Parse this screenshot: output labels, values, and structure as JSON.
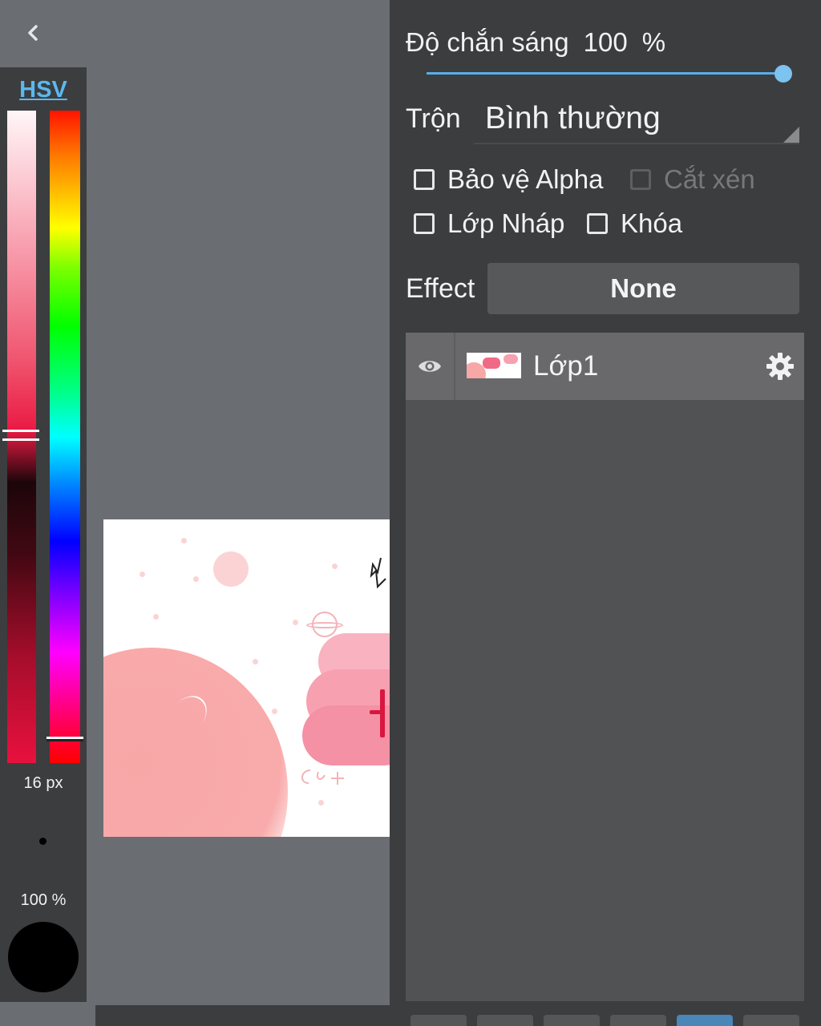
{
  "colors": {
    "accent": "#5bb8ee",
    "panel": "#3c3d3f",
    "canvas_bg": "#6a6d72",
    "current_color": "#000000"
  },
  "navigation": {
    "back_icon": "chevron-left-icon"
  },
  "color_panel": {
    "mode_label": "HSV",
    "brush_size": "16 px",
    "brush_opacity": "100 %",
    "saturation_level": 0.49,
    "hue_level": 0.96
  },
  "layer_properties": {
    "opacity_label": "Độ chắn sáng",
    "opacity_value": "100",
    "opacity_unit": "%",
    "opacity_slider": 1.0,
    "blend_label": "Trộn",
    "blend_value": "Bình thường",
    "checkboxes": [
      {
        "label": "Bảo vệ Alpha",
        "checked": false,
        "enabled": true
      },
      {
        "label": "Cắt xén",
        "checked": false,
        "enabled": false
      },
      {
        "label": "Lớp Nháp",
        "checked": false,
        "enabled": true
      },
      {
        "label": "Khóa",
        "checked": false,
        "enabled": true
      }
    ],
    "effect_label": "Effect",
    "effect_value": "None"
  },
  "layers": [
    {
      "name": "Lớp1",
      "visible": true,
      "icon": "eye-icon",
      "settings_icon": "gear-icon"
    }
  ]
}
